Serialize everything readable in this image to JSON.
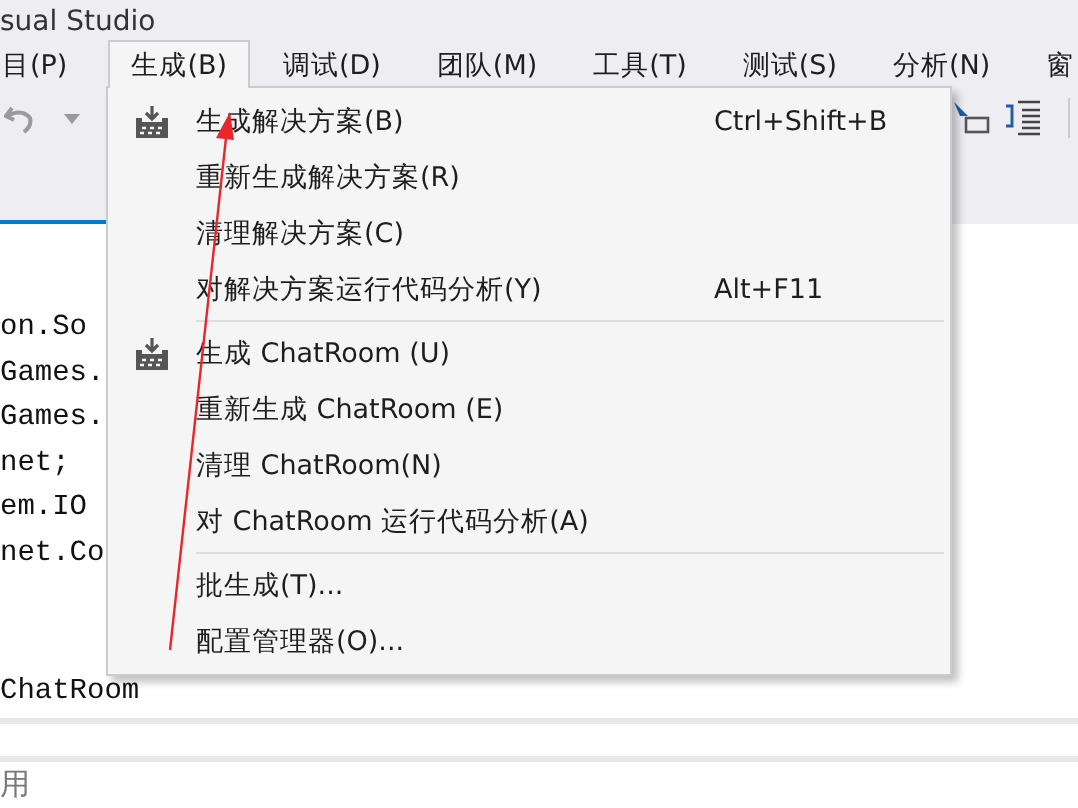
{
  "window": {
    "title": "sual Studio"
  },
  "menu_bar": [
    {
      "label": "目(P)",
      "selected": false
    },
    {
      "label": "生成(B)",
      "selected": true
    },
    {
      "label": "调试(D)",
      "selected": false
    },
    {
      "label": "团队(M)",
      "selected": false
    },
    {
      "label": "工具(T)",
      "selected": false
    },
    {
      "label": "测试(S)",
      "selected": false
    },
    {
      "label": "分析(N)",
      "selected": false
    },
    {
      "label": "窗",
      "selected": false
    }
  ],
  "build_menu": [
    {
      "kind": "icon-command",
      "label": "生成解决方案(B)",
      "shortcut": "Ctrl+Shift+B"
    },
    {
      "kind": "command",
      "label": "重新生成解决方案(R)"
    },
    {
      "kind": "command",
      "label": "清理解决方案(C)"
    },
    {
      "kind": "command",
      "label": "对解决方案运行代码分析(Y)",
      "shortcut": "Alt+F11"
    },
    {
      "kind": "separator"
    },
    {
      "kind": "icon-command",
      "label": "生成 ChatRoom (U)"
    },
    {
      "kind": "command",
      "label": "重新生成 ChatRoom (E)"
    },
    {
      "kind": "command",
      "label": "清理 ChatRoom(N)"
    },
    {
      "kind": "command",
      "label": "对 ChatRoom 运行代码分析(A)"
    },
    {
      "kind": "separator"
    },
    {
      "kind": "command",
      "label": "批生成(T)..."
    },
    {
      "kind": "command",
      "label": "配置管理器(O)..."
    }
  ],
  "editor": {
    "lines": [
      "on.So",
      "Games.",
      "Games.",
      "net;",
      "em.IO",
      "net.Co"
    ],
    "declaration": "ChatRoom"
  },
  "bottom_panel": {
    "text": "用"
  }
}
